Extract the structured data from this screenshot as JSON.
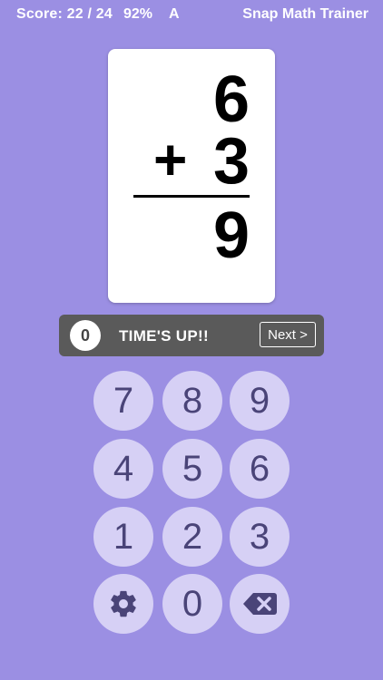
{
  "topbar": {
    "score": "Score: 22 / 24",
    "percent": "92%",
    "grade": "A",
    "app_title": "Snap Math Trainer"
  },
  "card": {
    "top_number": "6",
    "operator": "+",
    "bottom_number": "3",
    "answer": "9"
  },
  "status": {
    "timer_value": "0",
    "message": "TIME'S UP!!",
    "next_label": "Next >"
  },
  "keypad": {
    "keys": [
      "7",
      "8",
      "9",
      "4",
      "5",
      "6",
      "1",
      "2",
      "3"
    ],
    "zero": "0",
    "settings_icon": "gear-icon",
    "backspace_icon": "backspace-icon"
  },
  "colors": {
    "background": "#9b8fe3",
    "key_fill": "#d6d0f5",
    "key_text": "#4a4478",
    "status_bar": "#5a5a5a"
  }
}
